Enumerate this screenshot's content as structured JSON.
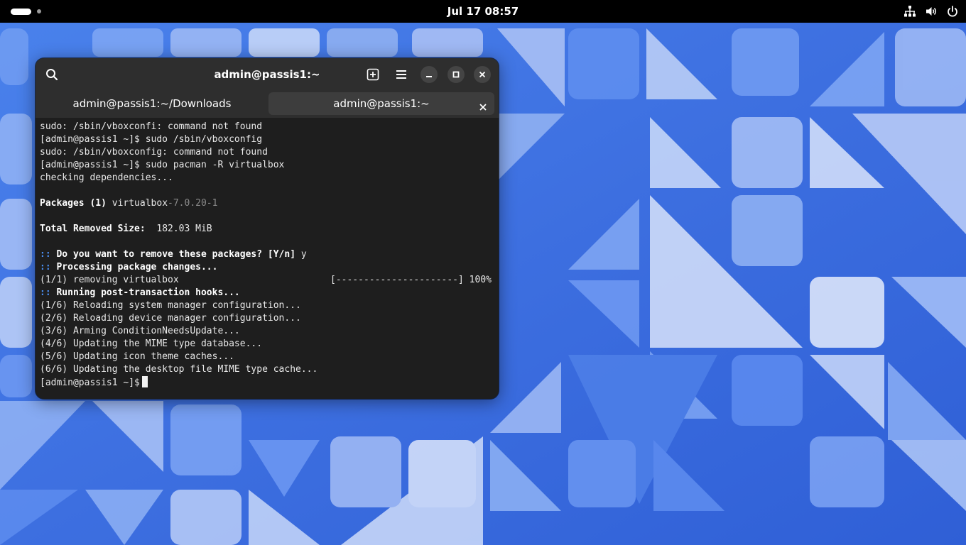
{
  "topbar": {
    "clock": "Jul 17  08:57",
    "icons": [
      "network-icon",
      "volume-icon",
      "power-icon"
    ]
  },
  "window": {
    "title": "admin@passis1:~",
    "buttons": [
      "search-icon",
      "new-tab-icon",
      "menu-icon",
      "minimize-icon",
      "maximize-icon",
      "close-icon"
    ]
  },
  "tabs": [
    {
      "label": "admin@passis1:~/Downloads",
      "active": false
    },
    {
      "label": "admin@passis1:~",
      "active": true
    }
  ],
  "terminal": {
    "l1": "sudo: /sbin/vboxconfi: command not found",
    "l2": "[admin@passis1 ~]$ sudo /sbin/vboxconfig",
    "l3": "sudo: /sbin/vboxconfig: command not found",
    "l4": "[admin@passis1 ~]$ sudo pacman -R virtualbox",
    "l5": "checking dependencies...",
    "packages_label": "Packages (1)",
    "package_name": " virtualbox",
    "package_version": "-7.0.20-1",
    "size_label": "Total Removed Size:",
    "size_value": "  182.03 MiB",
    "prefix": "::",
    "q_remove": " Do you want to remove these packages? [Y/n]",
    "q_answer": " y",
    "processing": " Processing package changes...",
    "removing": "(1/1) removing virtualbox",
    "progress": "[----------------------] 100%",
    "hooks": " Running post-transaction hooks...",
    "h1": "(1/6) Reloading system manager configuration...",
    "h2": "(2/6) Reloading device manager configuration...",
    "h3": "(3/6) Arming ConditionNeedsUpdate...",
    "h4": "(4/6) Updating the MIME type database...",
    "h5": "(5/6) Updating icon theme caches...",
    "h6": "(6/6) Updating the desktop file MIME type cache...",
    "prompt": "[admin@passis1 ~]$"
  },
  "colors": {
    "topbar": "#000000",
    "headerbar": "#2e2e2e",
    "terminal_bg": "#1e1e1e",
    "accent_blue": "#4a8df0",
    "wallpaper": "#3b6fe0"
  }
}
